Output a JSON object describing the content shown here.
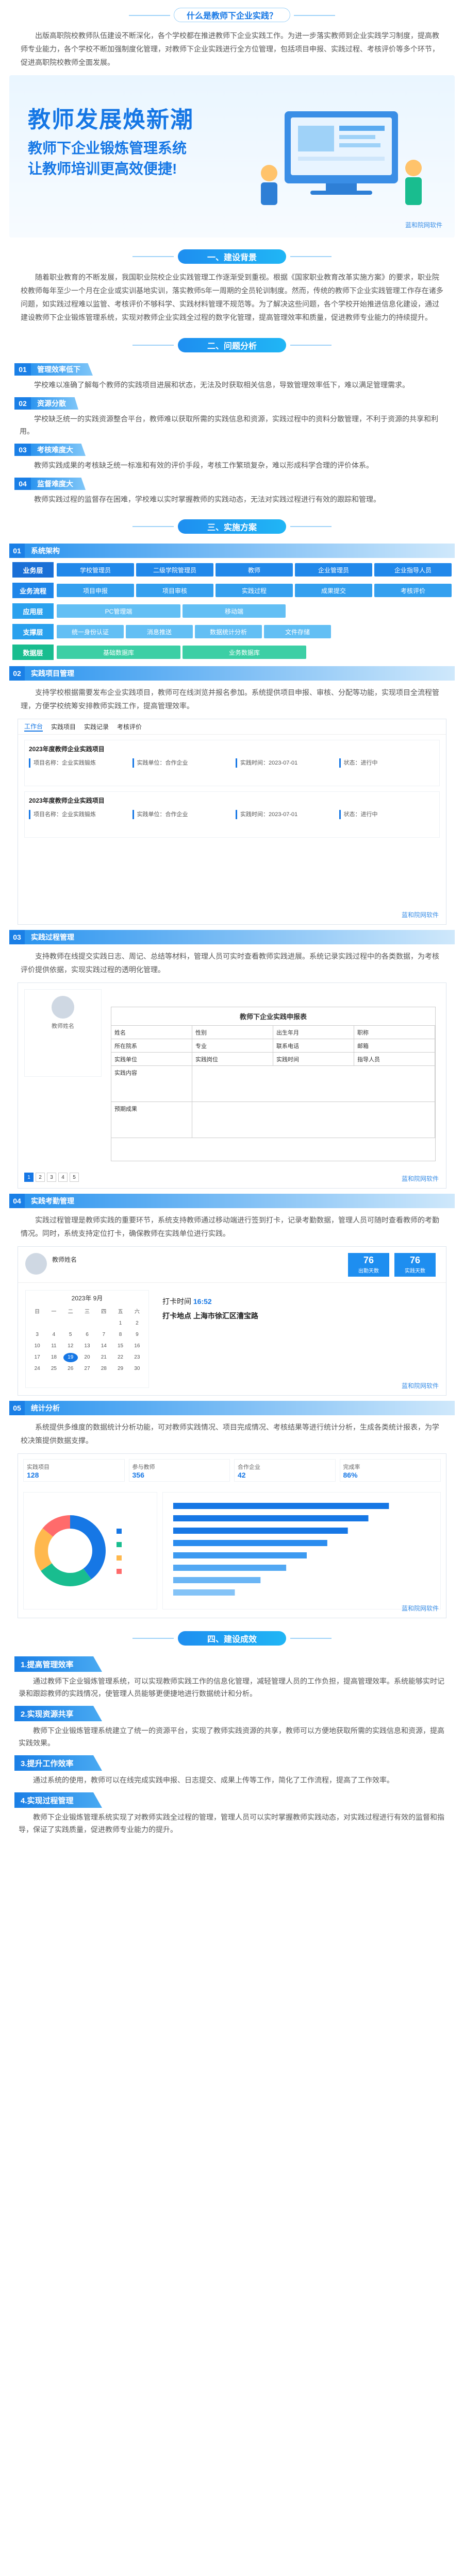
{
  "header": {
    "question": "什么是教师下企业实践？",
    "intro": "出版高职院校教师队伍建设不断深化，各个学校都在推进教师下企业实践工作。为进一步落实教师到企业实践学习制度，提高教师专业能力，各个学校不断加强制度化管理，对教师下企业实践进行全方位管理，包括项目申报、实践过程、考核评价等多个环节，促进高职院校教师全面发展。"
  },
  "hero": {
    "title": "教师发展焕新潮",
    "sub1": "教师下企业锻炼管理系统",
    "sub2": "让教师培训更高效便捷!",
    "logo": "蓝和院网软件"
  },
  "background": {
    "title": "一、建设背景",
    "text": "随着职业教育的不断发展，我国职业院校企业实践管理工作逐渐受到重视。根据《国家职业教育改革实施方案》的要求，职业院校教师每年至少一个月在企业或实训基地实训，落实教师5年一周期的全员轮训制度。然而，传统的教师下企业实践管理工作存在诸多问题，如实践过程难以监管、考核评价不够科学、实践材料管理不规范等。为了解决这些问题，各个学校开始推进信息化建设，通过建设教师下企业锻炼管理系统，实现对教师企业实践全过程的数字化管理，提高管理效率和质量，促进教师专业能力的持续提升。"
  },
  "analysis": {
    "title": "二、问题分析",
    "items": [
      {
        "num": "01",
        "label": "管理效率低下",
        "text": "学校难以准确了解每个教师的实践项目进展和状态，无法及时获取相关信息，导致管理效率低下，难以满足管理需求。"
      },
      {
        "num": "02",
        "label": "资源分散",
        "text": "学校缺乏统一的实践资源整合平台，教师难以获取所需的实践信息和资源，实践过程中的资料分散管理，不利于资源的共享和利用。"
      },
      {
        "num": "03",
        "label": "考核难度大",
        "text": "教师实践成果的考核缺乏统一标准和有效的评价手段，考核工作繁琐复杂，难以形成科学合理的评价体系。"
      },
      {
        "num": "04",
        "label": "监督难度大",
        "text": "教师实践过程的监督存在困难，学校难以实时掌握教师的实践动态，无法对实践过程进行有效的跟踪和管理。"
      }
    ]
  },
  "solution": {
    "title": "三、实施方案",
    "arch_num": "01",
    "arch_label": "系统架构",
    "arch_rows": [
      {
        "label": "业务层",
        "items": [
          "学校管理员",
          "二级学院管理员",
          "教师",
          "企业管理员",
          "企业指导人员"
        ]
      },
      {
        "label": "业务流程",
        "items": [
          "项目申报",
          "项目审核",
          "实践过程",
          "成果提交",
          "考核评价"
        ]
      },
      {
        "label": "应用层",
        "items": [
          "PC管理端",
          "移动端"
        ]
      },
      {
        "label": "支撑层",
        "items": [
          "统一身份认证",
          "消息推送",
          "数据统计分析",
          "文件存储"
        ]
      },
      {
        "label": "数据层",
        "items": [
          "基础数据库",
          "业务数据库"
        ]
      }
    ],
    "features": [
      {
        "num": "02",
        "label": "实践项目管理",
        "text": "支持学校根据需要发布企业实践项目，教师可在线浏览并报名参加。系统提供项目申报、审核、分配等功能，实现项目全流程管理，方便学校统筹安排教师实践工作，提高管理效率。"
      },
      {
        "num": "03",
        "label": "实践过程管理",
        "text": "支持教师在线提交实践日志、周记、总结等材料，管理人员可实时查看教师实践进展。系统记录实践过程中的各类数据，为考核评价提供依据，实现实践过程的透明化管理。"
      },
      {
        "num": "04",
        "label": "实践考勤管理",
        "text": "实践过程管理是教师实践的重要环节，系统支持教师通过移动端进行签到打卡，记录考勤数据，管理人员可随时查看教师的考勤情况。同时，系统支持定位打卡，确保教师在实践单位进行实践。"
      },
      {
        "num": "05",
        "label": "统计分析",
        "text": "系统提供多维度的数据统计分析功能，可对教师实践情况、项目完成情况、考核结果等进行统计分析，生成各类统计报表，为学校决策提供数据支撑。"
      }
    ],
    "shot1": {
      "tabs": [
        "工作台",
        "实践项目",
        "实践记录",
        "考核评价"
      ],
      "project": "2023年度教师企业实践项目",
      "c1": "项目名称：企业实践锻炼",
      "c2": "实践单位：合作企业",
      "c3": "实践时间：2023-07-01",
      "c4": "状态：进行中"
    },
    "shot2": {
      "name": "教师姓名",
      "form_title": "教师下企业实践申报表",
      "row1": [
        "姓名",
        "性别",
        "出生年月",
        "职称"
      ],
      "row2": [
        "所在院系",
        "专业",
        "联系电话",
        "邮箱"
      ],
      "row3": [
        "实践单位",
        "实践岗位",
        "实践时间",
        "指导人员"
      ],
      "row4": [
        "实践内容",
        "",
        "",
        ""
      ],
      "row5": [
        "预期成果",
        "",
        "",
        ""
      ],
      "pages": [
        "1",
        "2",
        "3",
        "4",
        "5"
      ]
    },
    "shot3": {
      "name": "教师姓名",
      "stat1_v": "76",
      "stat1_l": "出勤天数",
      "stat2_v": "76",
      "stat2_l": "实践天数",
      "month": "2023年 9月",
      "weekdays": [
        "日",
        "一",
        "二",
        "三",
        "四",
        "五",
        "六"
      ],
      "clock_label": "打卡时间",
      "clock_time": "16:52",
      "loc_label": "打卡地点",
      "loc_text": "上海市徐汇区漕宝路"
    },
    "shot4": {
      "stats": [
        {
          "l": "实践项目",
          "v": "128"
        },
        {
          "l": "参与教师",
          "v": "356"
        },
        {
          "l": "合作企业",
          "v": "42"
        },
        {
          "l": "完成率",
          "v": "86%"
        }
      ]
    }
  },
  "summary": {
    "title": "四、建设成效",
    "items": [
      {
        "label": "1.提高管理效率",
        "text": "通过教师下企业锻炼管理系统，可以实现教师实践工作的信息化管理，减轻管理人员的工作负担，提高管理效率。系统能够实时记录和跟踪教师的实践情况，使管理人员能够更便捷地进行数据统计和分析。"
      },
      {
        "label": "2.实现资源共享",
        "text": "教师下企业锻炼管理系统建立了统一的资源平台，实现了教师实践资源的共享，教师可以方便地获取所需的实践信息和资源，提高实践效果。"
      },
      {
        "label": "3.提升工作效率",
        "text": "通过系统的使用，教师可以在线完成实践申报、日志提交、成果上传等工作，简化了工作流程，提高了工作效率。"
      },
      {
        "label": "4.实现过程管理",
        "text": "教师下企业锻炼管理系统实现了对教师实践全过程的管理，管理人员可以实时掌握教师实践动态，对实践过程进行有效的监督和指导，保证了实践质量，促进教师专业能力的提升。"
      }
    ]
  },
  "watermark": "蓝和院网软件",
  "colors": {
    "primary": "#1677e5",
    "accent": "#20b6f5",
    "green": "#19bd8f"
  }
}
